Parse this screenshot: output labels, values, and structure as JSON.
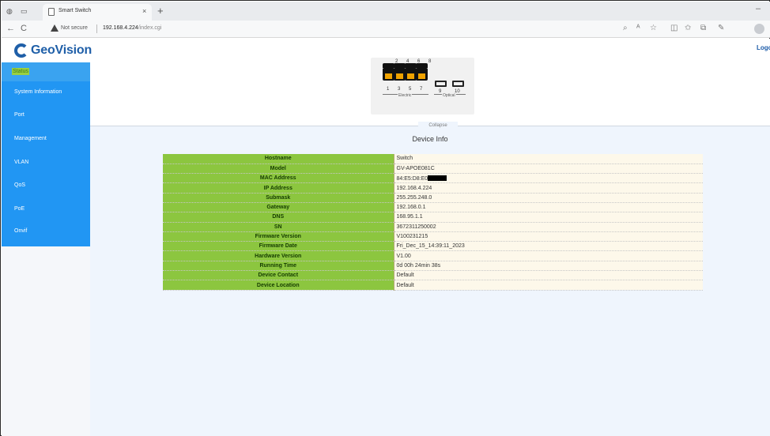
{
  "browser": {
    "tab_title": "Smart Switch",
    "tab_close": "×",
    "new_tab": "+",
    "minimize": "–",
    "back": "←",
    "reload": "C",
    "security_label": "Not secure",
    "url_host": "192.168.4.224",
    "url_path": "/index.cgi"
  },
  "header": {
    "logo_text": "GeoVision",
    "logout_label": "Logo"
  },
  "sidebar": {
    "status_label": "Status",
    "menu": [
      {
        "label": "System Information"
      },
      {
        "label": "Port"
      },
      {
        "label": "Management"
      },
      {
        "label": "VLAN"
      },
      {
        "label": "QoS"
      },
      {
        "label": "PoE"
      },
      {
        "label": "Onvif"
      }
    ]
  },
  "switch_panel": {
    "top_ports": [
      "2",
      "4",
      "6",
      "8"
    ],
    "bottom_ports": [
      "1",
      "3",
      "5",
      "7"
    ],
    "optical_ports": [
      "9",
      "10"
    ],
    "electric_label": "Electric",
    "optical_label": "Optical"
  },
  "collapse_label": "Collapse",
  "device_info": {
    "title": "Device Info",
    "rows": [
      {
        "key": "Hostname",
        "value": "Switch"
      },
      {
        "key": "Model",
        "value": "GV-APOE081C"
      },
      {
        "key": "MAC Address",
        "value": "84:E5:D8:E0"
      },
      {
        "key": "IP Address",
        "value": "192.168.4.224"
      },
      {
        "key": "Submask",
        "value": "255.255.248.0"
      },
      {
        "key": "Gateway",
        "value": "192.168.0.1"
      },
      {
        "key": "DNS",
        "value": "168.95.1.1"
      },
      {
        "key": "SN",
        "value": "3672311250002"
      },
      {
        "key": "Firmware Version",
        "value": "V100231215"
      },
      {
        "key": "Firmware Date",
        "value": "Fri_Dec_15_14:39:11_2023"
      },
      {
        "key": "Hardware Version",
        "value": "V1.00"
      },
      {
        "key": "Running Time",
        "value": "0d 00h 24min 38s"
      },
      {
        "key": "Device Contact",
        "value": "Default"
      },
      {
        "key": "Device Location",
        "value": "Default"
      }
    ]
  },
  "colors": {
    "sidebar_blue": "#2196f3",
    "sidebar_top": "#3aa3f0",
    "key_green": "#8cc63f",
    "value_bg": "#fdf8ea",
    "logo_blue": "#1f5fa8"
  }
}
